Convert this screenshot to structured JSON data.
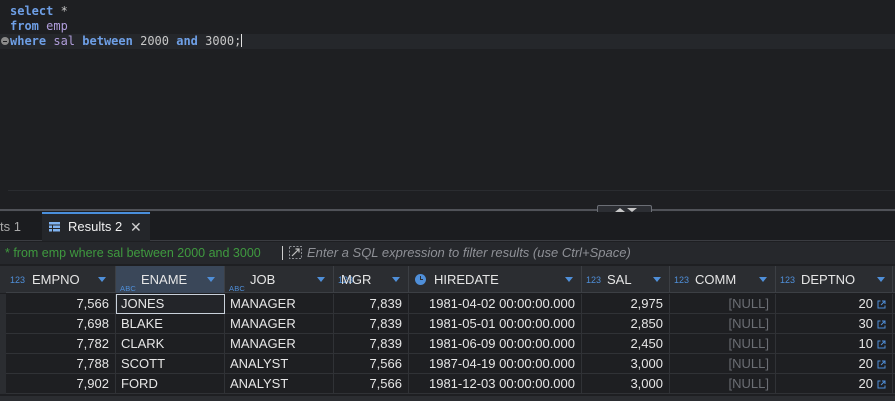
{
  "editor": {
    "line1": {
      "kw": "select",
      "rest": " *"
    },
    "line2": {
      "kw": "from",
      "ident": "emp"
    },
    "line3": {
      "kw_where": "where",
      "col": "sal",
      "kw_between": "between",
      "low": "2000",
      "kw_and": "and",
      "high": "3000",
      "end": ";"
    }
  },
  "tabs": {
    "previous_label": "ts 1",
    "active_label": "Results 2",
    "close_glyph": "✕"
  },
  "filter": {
    "current_text": "* from emp where sal between 2000 and 3000",
    "placeholder": "Enter a SQL expression to filter results (use Ctrl+Space)"
  },
  "grid": {
    "columns": [
      {
        "name": "EMPNO",
        "type_glyph": "123"
      },
      {
        "name": "ENAME",
        "type_glyph": "ABC"
      },
      {
        "name": "JOB",
        "type_glyph": "ABC"
      },
      {
        "name": "MGR",
        "type_glyph": "123"
      },
      {
        "name": "HIREDATE",
        "type_glyph": "clock"
      },
      {
        "name": "SAL",
        "type_glyph": "123"
      },
      {
        "name": "COMM",
        "type_glyph": "123"
      },
      {
        "name": "DEPTNO",
        "type_glyph": "123"
      }
    ],
    "rows": [
      [
        "7,566",
        "JONES",
        "MANAGER",
        "7,839",
        "1981-04-02 00:00:00.000",
        "2,975",
        "[NULL]",
        "20"
      ],
      [
        "7,698",
        "BLAKE",
        "MANAGER",
        "7,839",
        "1981-05-01 00:00:00.000",
        "2,850",
        "[NULL]",
        "30"
      ],
      [
        "7,782",
        "CLARK",
        "MANAGER",
        "7,839",
        "1981-06-09 00:00:00.000",
        "2,450",
        "[NULL]",
        "10"
      ],
      [
        "7,788",
        "SCOTT",
        "ANALYST",
        "7,566",
        "1987-04-19 00:00:00.000",
        "3,000",
        "[NULL]",
        "20"
      ],
      [
        "7,902",
        "FORD",
        "ANALYST",
        "7,566",
        "1981-12-03 00:00:00.000",
        "3,000",
        "[NULL]",
        "20"
      ]
    ],
    "selected_column": "ENAME",
    "focused_cell": "JONES"
  },
  "colors": {
    "keyword": "#6e9fe6",
    "identifier": "#b09ddb",
    "filter_text": "#3f9a3f",
    "accent": "#4f8fd9",
    "null_text": "#6b6e74"
  }
}
